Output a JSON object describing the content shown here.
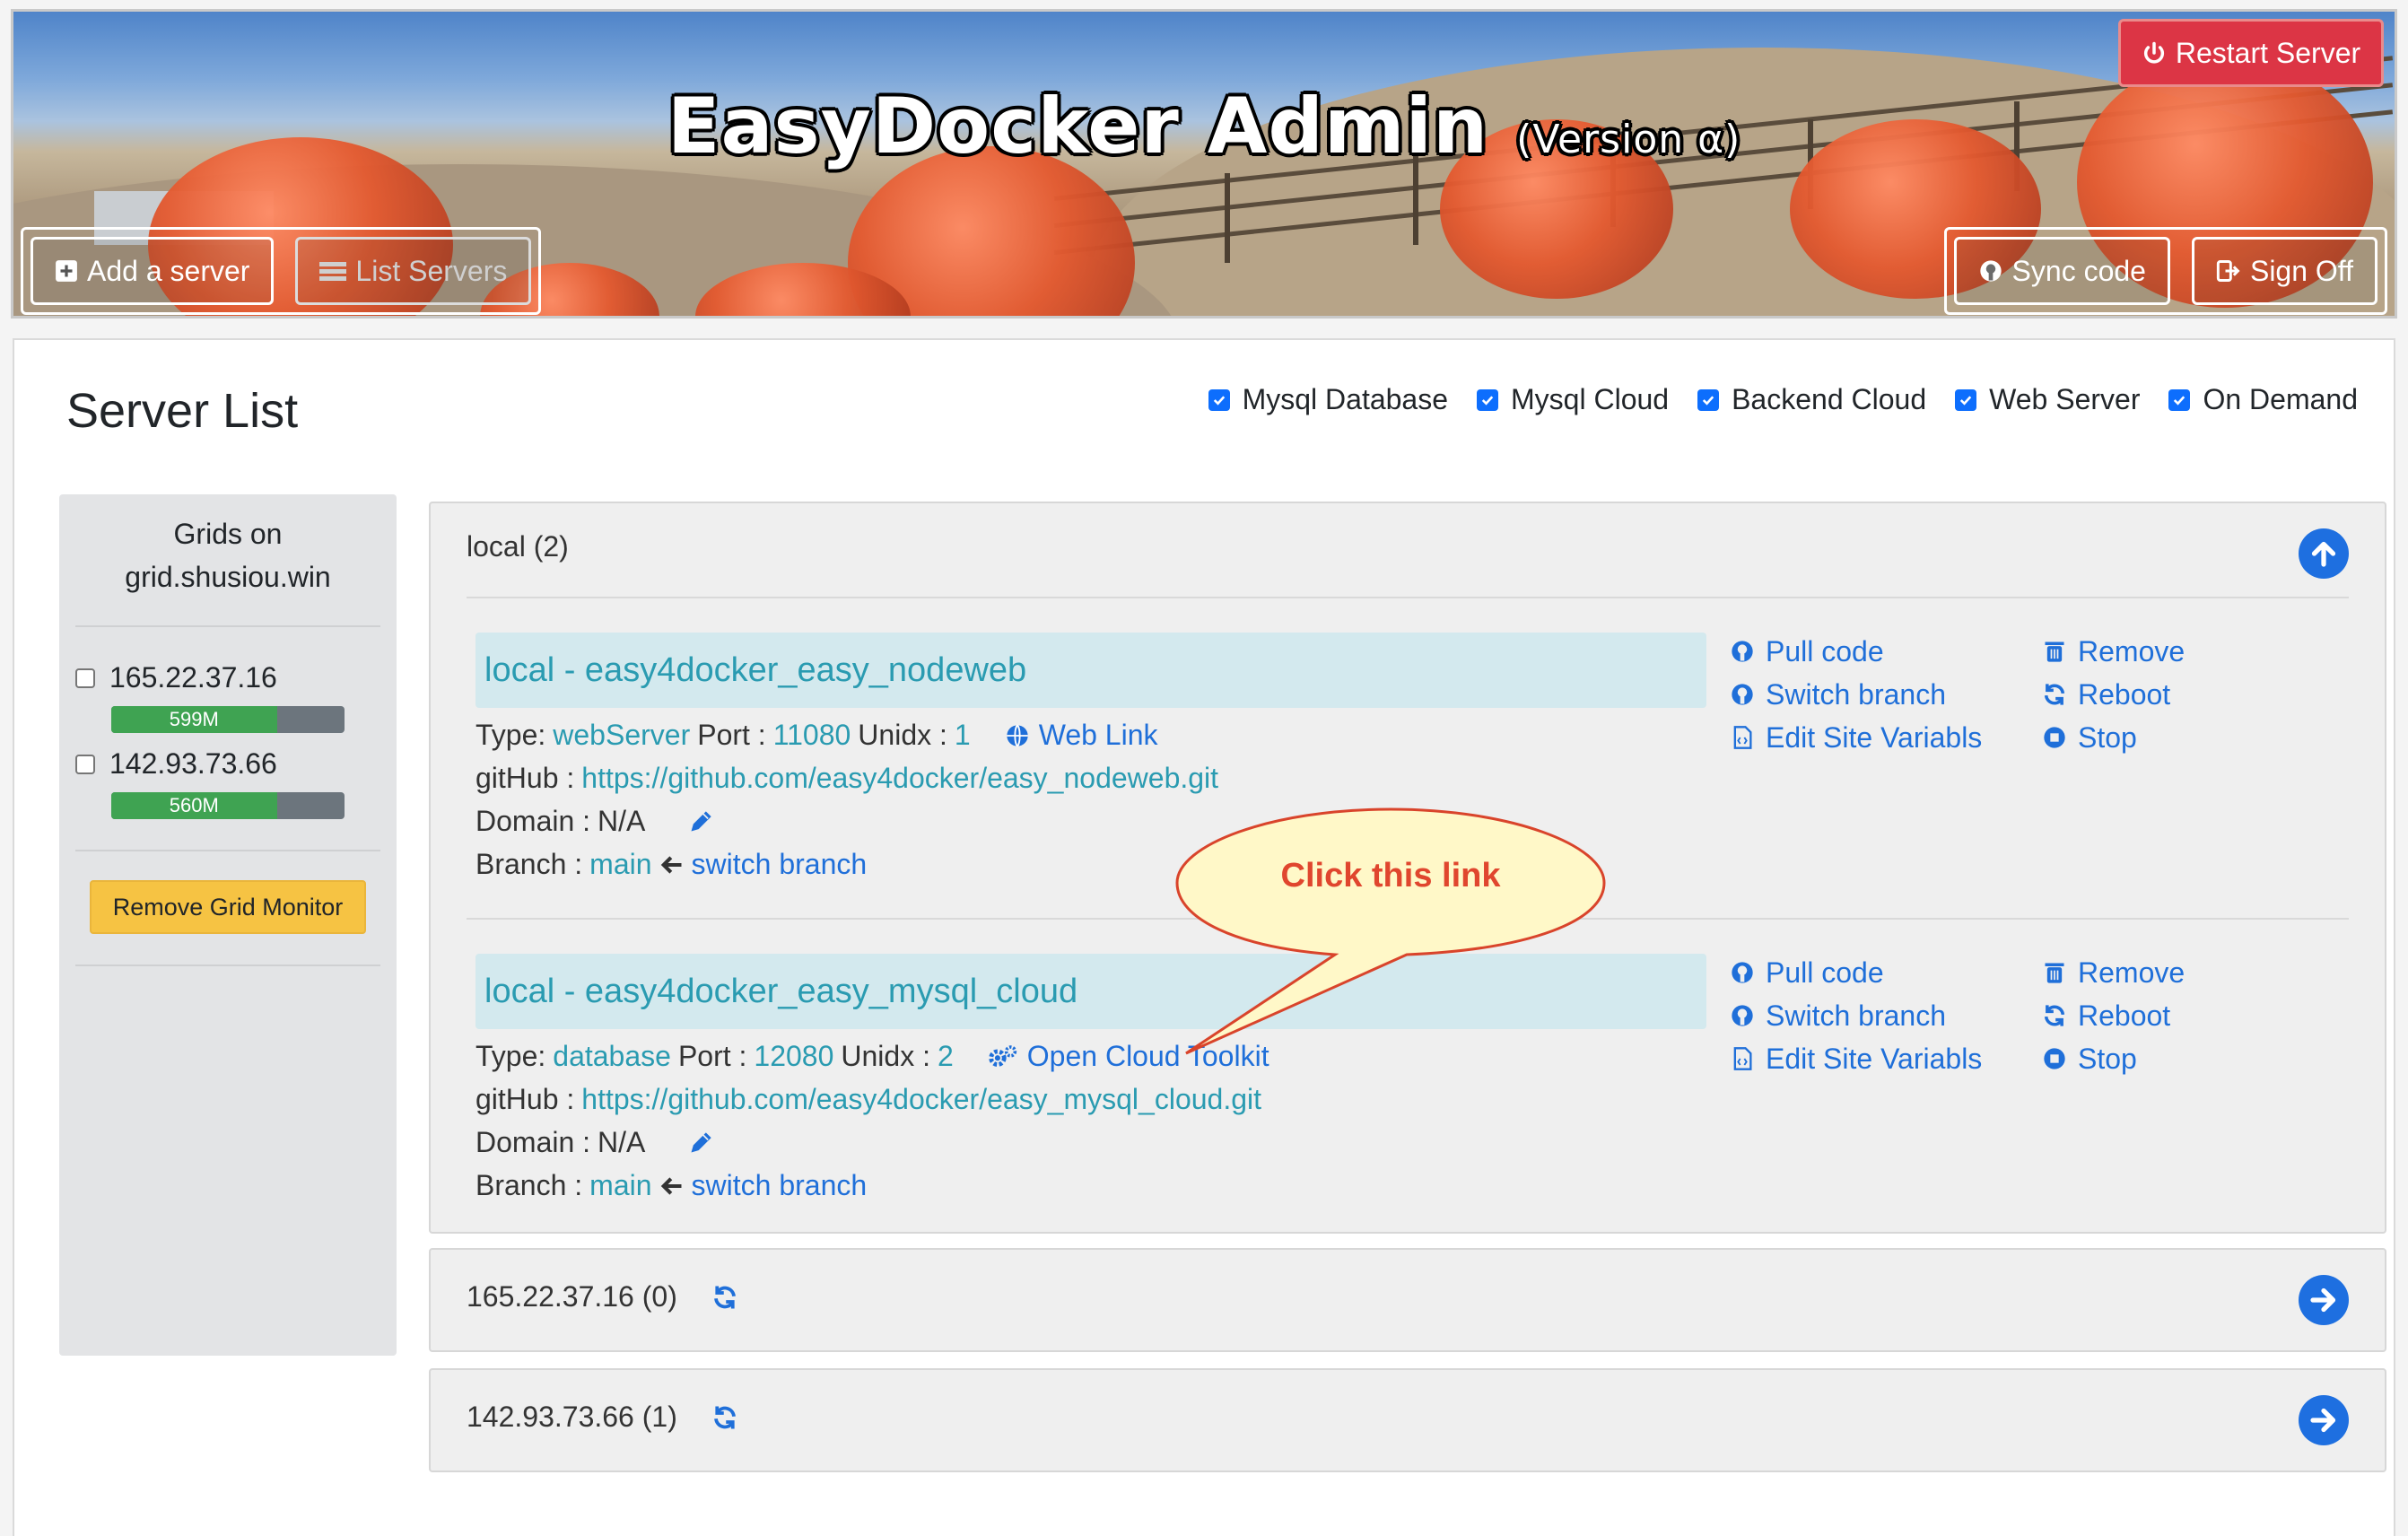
{
  "header": {
    "title": "EasyDocker Admin",
    "version": "(Version α)",
    "restart_label": "Restart Server",
    "add_server_label": "Add a server",
    "list_servers_label": "List Servers",
    "sync_code_label": "Sync code",
    "sign_off_label": "Sign Off"
  },
  "main": {
    "title": "Server List",
    "filters": [
      {
        "label": "Mysql Database",
        "checked": true
      },
      {
        "label": "Mysql Cloud",
        "checked": true
      },
      {
        "label": "Backend Cloud",
        "checked": true
      },
      {
        "label": "Web Server",
        "checked": true
      },
      {
        "label": "On Demand",
        "checked": true
      }
    ]
  },
  "sidebar": {
    "title_line1": "Grids on",
    "title_line2": "grid.shusiou.win",
    "grids": [
      {
        "ip": "165.22.37.16",
        "memory": "599M",
        "usage_fraction": 0.71
      },
      {
        "ip": "142.93.73.66",
        "memory": "560M",
        "usage_fraction": 0.71
      }
    ],
    "remove_label": "Remove Grid Monitor"
  },
  "groups": [
    {
      "title": "local (2)",
      "servers": [
        {
          "name": "local - easy4docker_easy_nodeweb",
          "type_label": "Type:",
          "type": "webServer",
          "port_label": "Port :",
          "port": "11080",
          "unidx_label": "Unidx :",
          "unidx": "1",
          "link_label": "Web Link",
          "github_label": "gitHub :",
          "github": "https://github.com/easy4docker/easy_nodeweb.git",
          "domain_label": "Domain :",
          "domain": "N/A",
          "branch_label": "Branch :",
          "branch": "main",
          "switch_label": "switch branch"
        },
        {
          "name": "local - easy4docker_easy_mysql_cloud",
          "type_label": "Type:",
          "type": "database",
          "port_label": "Port :",
          "port": "12080",
          "unidx_label": "Unidx :",
          "unidx": "2",
          "link_label": "Open Cloud Toolkit",
          "github_label": "gitHub :",
          "github": "https://github.com/easy4docker/easy_mysql_cloud.git",
          "domain_label": "Domain :",
          "domain": "N/A",
          "branch_label": "Branch :",
          "branch": "main",
          "switch_label": "switch branch"
        }
      ]
    },
    {
      "title": "165.22.37.16 (0)"
    },
    {
      "title": "142.93.73.66 (1)"
    }
  ],
  "actions": {
    "pull_code": "Pull code",
    "switch_branch": "Switch branch",
    "edit_site": "Edit Site Variabls",
    "remove": "Remove",
    "reboot": "Reboot",
    "stop": "Stop"
  },
  "callout": {
    "text": "Click this link"
  },
  "colors": {
    "primary": "#1f6fd9",
    "teal": "#2a9bb1",
    "danger": "#dc3545",
    "warning": "#f6c343",
    "success": "#3fa352"
  }
}
